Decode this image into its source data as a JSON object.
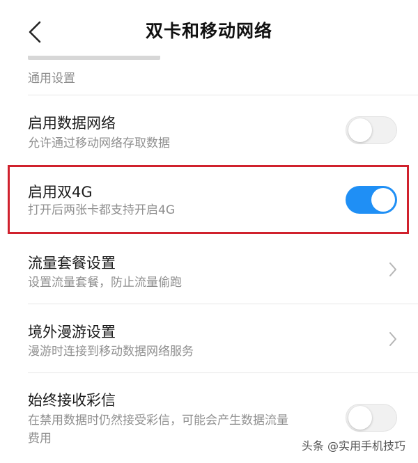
{
  "header": {
    "title": "双卡和移动网络"
  },
  "previous_row": {
    "subtitle": "通用设置"
  },
  "settings": {
    "enable_data": {
      "label": "启用数据网络",
      "description": "允许通过移动网络存取数据",
      "enabled": false
    },
    "dual_4g": {
      "label": "启用双4G",
      "description": "打开后两张卡都支持开启4G",
      "enabled": true
    },
    "data_plan": {
      "label": "流量套餐设置",
      "description": "设置流量套餐，防止流量偷跑"
    },
    "roaming": {
      "label": "境外漫游设置",
      "description": "漫游时连接到移动数据网络服务"
    },
    "always_mms": {
      "label": "始终接收彩信",
      "description_line1": "在禁用数据时仍然接受彩信，可能会产生数据流量",
      "description_line2": "费用",
      "enabled": false
    }
  },
  "watermark": "头条 @实用手机技巧",
  "colors": {
    "toggle_on": "#1f8ff5",
    "highlight": "#d0212d"
  },
  "icons": {
    "back": "chevron-left",
    "row_arrow": "chevron-right"
  }
}
